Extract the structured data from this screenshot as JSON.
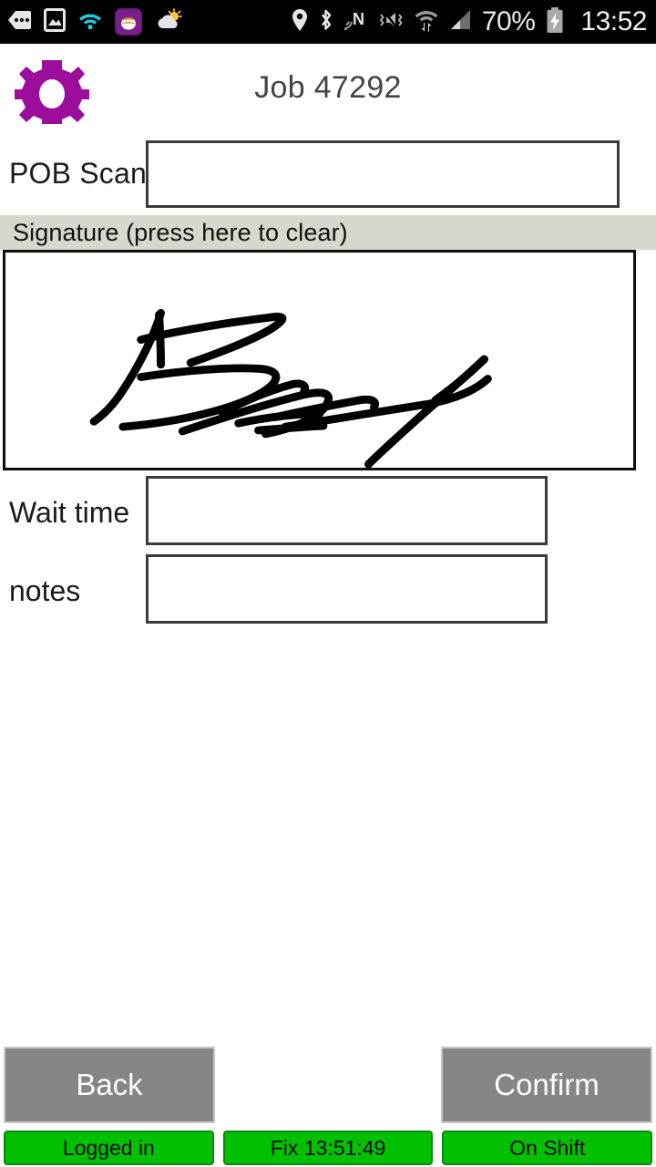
{
  "statusbar": {
    "battery_percent": "70%",
    "clock": "13:52",
    "left_icons": [
      {
        "name": "more-notifications-icon"
      },
      {
        "name": "screenshot-image-icon"
      },
      {
        "name": "wifi-cyan-icon"
      },
      {
        "name": "app-notification-icon"
      },
      {
        "name": "weather-partly-cloudy-icon"
      }
    ],
    "right_icons": [
      {
        "name": "location-pin-icon"
      },
      {
        "name": "bluetooth-icon"
      },
      {
        "name": "nfc-icon"
      },
      {
        "name": "volume-vibrate-mute-icon"
      },
      {
        "name": "wifi-transfer-icon"
      },
      {
        "name": "cellular-signal-icon"
      },
      {
        "name": "battery-charging-icon"
      }
    ]
  },
  "header": {
    "title": "Job 47292",
    "gear_icon": "gear-icon"
  },
  "form": {
    "pob": {
      "label": "POB Scan",
      "value": "",
      "placeholder": ""
    },
    "signature": {
      "bar_label": "Signature (press here to clear)",
      "has_signature": true
    },
    "wait_time": {
      "label": "Wait time",
      "value": "",
      "placeholder": ""
    },
    "notes": {
      "label": "notes",
      "value": "",
      "placeholder": ""
    }
  },
  "actions": {
    "back_label": "Back",
    "confirm_label": "Confirm"
  },
  "status_strip": {
    "login_status": "Logged in",
    "gps_fix": "Fix 13:51:49",
    "shift_status": "On Shift"
  },
  "colors": {
    "accent_gear": "#9c0d9c",
    "status_green": "#00c000",
    "button_gray": "#868686",
    "signature_bar": "#d8d7cd",
    "field_border": "#3b3b3b"
  }
}
